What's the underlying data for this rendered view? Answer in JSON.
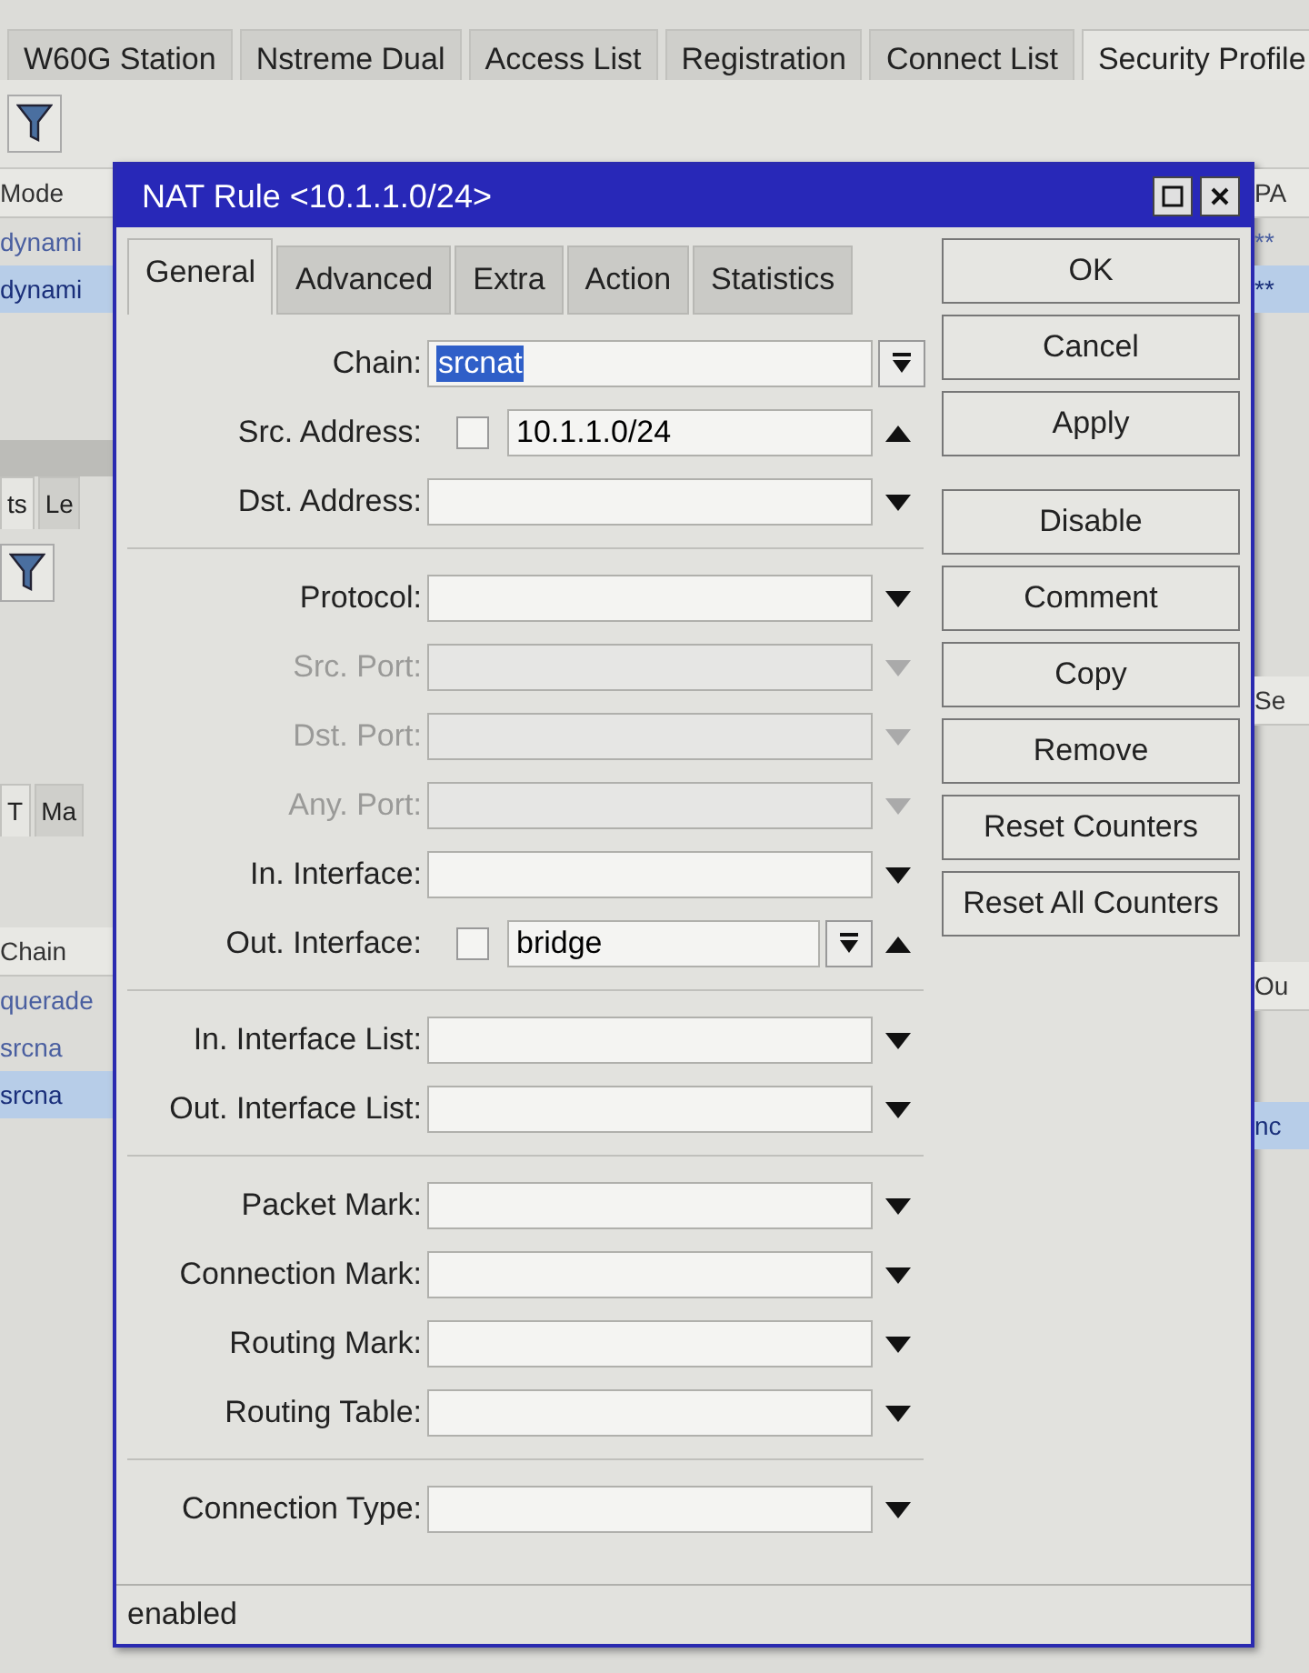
{
  "background": {
    "tabs": [
      {
        "label": "W60G Station",
        "selected": false
      },
      {
        "label": "Nstreme Dual",
        "selected": false
      },
      {
        "label": "Access List",
        "selected": false
      },
      {
        "label": "Registration",
        "selected": false
      },
      {
        "label": "Connect List",
        "selected": false
      },
      {
        "label": "Security Profile",
        "selected": true
      }
    ],
    "left_column": {
      "header": "Mode",
      "rows": [
        {
          "text": "dynami",
          "selected": false
        },
        {
          "text": "dynami",
          "selected": true
        }
      ],
      "tabs": [
        {
          "label": "ts",
          "selected": true
        },
        {
          "label": "Le",
          "selected": false
        }
      ],
      "tabs_2": [
        {
          "label": "T",
          "selected": true
        },
        {
          "label": "Ma",
          "selected": false
        }
      ],
      "header_2": "Chain",
      "rows_2": [
        {
          "text": "querade",
          "selected": false
        },
        {
          "text": "srcna",
          "selected": false
        },
        {
          "text": "srcna",
          "selected": true
        }
      ]
    },
    "right_column": {
      "header": "PA",
      "rows": [
        {
          "text": "**",
          "selected": false
        },
        {
          "text": "**",
          "selected": true
        }
      ],
      "header_2": "Se",
      "header_3": "Ou",
      "rows_2": [
        {
          "text": "nc",
          "selected": true
        }
      ]
    }
  },
  "dialog": {
    "title": "NAT Rule <10.1.1.0/24>",
    "tabs": [
      {
        "label": "General",
        "selected": true
      },
      {
        "label": "Advanced",
        "selected": false
      },
      {
        "label": "Extra",
        "selected": false
      },
      {
        "label": "Action",
        "selected": false
      },
      {
        "label": "Statistics",
        "selected": false
      }
    ],
    "groups": [
      [
        {
          "label": "Chain:",
          "kind": "combo",
          "value": "srcnat",
          "value_selected": true,
          "disabled": false
        },
        {
          "label": "Src. Address:",
          "kind": "set_text",
          "value": "10.1.1.0/24",
          "negated": false,
          "disabled": false
        },
        {
          "label": "Dst. Address:",
          "kind": "select",
          "disabled": false
        }
      ],
      [
        {
          "label": "Protocol:",
          "kind": "select",
          "disabled": false
        },
        {
          "label": "Src. Port:",
          "kind": "select",
          "disabled": true
        },
        {
          "label": "Dst. Port:",
          "kind": "select",
          "disabled": true
        },
        {
          "label": "Any. Port:",
          "kind": "select",
          "disabled": true
        },
        {
          "label": "In. Interface:",
          "kind": "select",
          "disabled": false
        },
        {
          "label": "Out. Interface:",
          "kind": "set_select",
          "value": "bridge",
          "negated": false,
          "disabled": false
        }
      ],
      [
        {
          "label": "In. Interface List:",
          "kind": "select",
          "disabled": false
        },
        {
          "label": "Out. Interface List:",
          "kind": "select",
          "disabled": false
        }
      ],
      [
        {
          "label": "Packet Mark:",
          "kind": "select",
          "disabled": false
        },
        {
          "label": "Connection Mark:",
          "kind": "select",
          "disabled": false
        },
        {
          "label": "Routing Mark:",
          "kind": "select",
          "disabled": false
        },
        {
          "label": "Routing Table:",
          "kind": "select",
          "disabled": false
        }
      ],
      [
        {
          "label": "Connection Type:",
          "kind": "select",
          "disabled": false
        }
      ]
    ],
    "buttons": [
      [
        "OK",
        "Cancel",
        "Apply"
      ],
      [
        "Disable",
        "Comment",
        "Copy",
        "Remove",
        "Reset Counters",
        "Reset All Counters"
      ]
    ],
    "status": "enabled"
  }
}
